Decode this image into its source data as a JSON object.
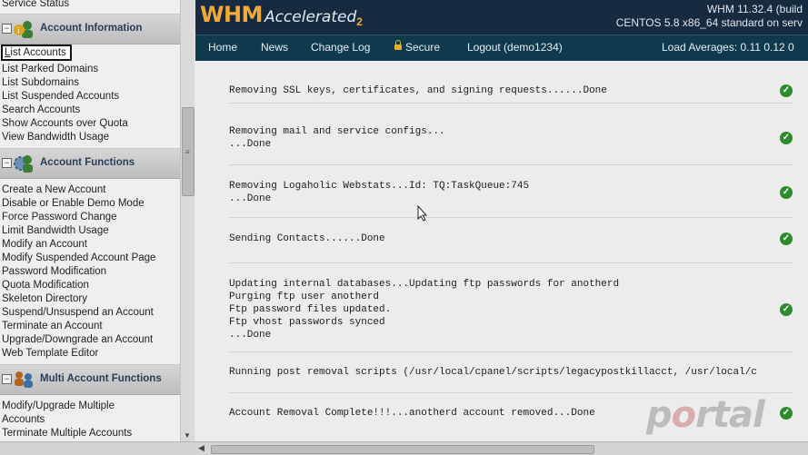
{
  "sidebar": {
    "top_cut": "Service Status",
    "account_information": {
      "header": "Account Information",
      "items": [
        "List Accounts",
        "List Parked Domains",
        "List Subdomains",
        "List Suspended Accounts",
        "Search Accounts",
        "Show Accounts over Quota",
        "View Bandwidth Usage"
      ]
    },
    "account_functions": {
      "header": "Account Functions",
      "items": [
        "Create a New Account",
        "Disable or Enable Demo Mode",
        "Force Password Change",
        "Limit Bandwidth Usage",
        "Modify an Account",
        "Modify Suspended Account Page",
        "Password Modification",
        "Quota Modification",
        "Skeleton Directory",
        "Suspend/Unsuspend an Account",
        "Terminate an Account",
        "Upgrade/Downgrade an Account",
        "Web Template Editor"
      ]
    },
    "multi_account_functions": {
      "header": "Multi Account Functions",
      "items": [
        "Modify/Upgrade Multiple",
        "Accounts",
        "Terminate Multiple Accounts"
      ]
    }
  },
  "header": {
    "logo_whm": "WHM",
    "logo_accelerated": "Accelerated",
    "logo_version": "2",
    "build_line1": "WHM 11.32.4 (build",
    "build_line2": "CENTOS 5.8 x86_64 standard on serv"
  },
  "nav": {
    "home": "Home",
    "news": "News",
    "changelog": "Change Log",
    "secure": "Secure",
    "logout": "Logout (demo1234)",
    "load": "Load Averages: 0.11 0.12 0"
  },
  "results": [
    {
      "text": "Removing SSL keys, certificates, and signing requests......Done",
      "ok": true
    },
    {
      "text": "Removing mail and service configs...\n...Done",
      "ok": true
    },
    {
      "text": "Removing Logaholic Webstats...Id: TQ:TaskQueue:745\n...Done",
      "ok": true
    },
    {
      "text": "Sending Contacts......Done",
      "ok": true
    },
    {
      "text": "Updating internal databases...Updating ftp passwords for anotherd\nPurging ftp user anotherd\nFtp password files updated.\nFtp vhost passwords synced\n...Done",
      "ok": true
    },
    {
      "text": "Running post removal scripts (/usr/local/cpanel/scripts/legacypostkillacct, /usr/local/c",
      "ok": false
    },
    {
      "text": "Account Removal Complete!!!...anotherd account removed...Done",
      "ok": true
    }
  ],
  "watermark": {
    "pre": "p",
    "o": "o",
    "post": "rtal"
  },
  "colors": {
    "header_bg": "#162a40",
    "nav_bg": "#0f3a4d",
    "logo_orange": "#f2a93a",
    "check_green": "#2d8b2d"
  }
}
